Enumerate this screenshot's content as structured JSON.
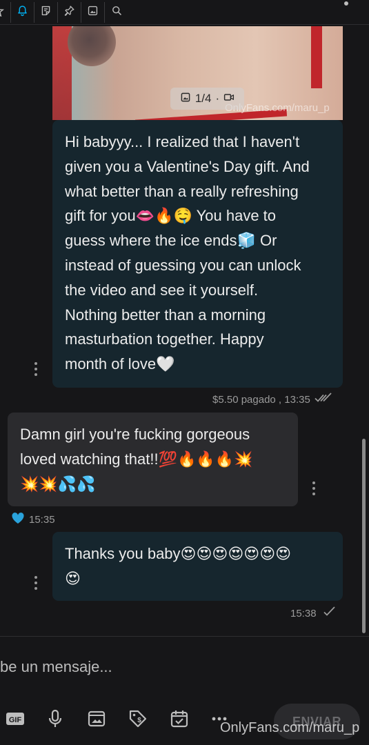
{
  "toolbar": {
    "icons": [
      "star-icon",
      "bell-icon",
      "note-icon",
      "pin-icon",
      "image-icon",
      "search-icon"
    ]
  },
  "messages": [
    {
      "direction": "outgoing",
      "media_counter": "1/4",
      "media_watermark": "OnlyFans.com/maru_p",
      "lines": [
        "Hi babyyy... I realized that I haven't",
        "given you a Valentine's Day gift. And",
        "what better than a really refreshing",
        "gift for you👄🔥🤤 You have to",
        "guess where the ice ends🧊 Or",
        "instead of guessing you can unlock",
        "the video and see it yourself.",
        "Nothing better than a morning",
        "masturbation together. Happy",
        "month of love🤍"
      ],
      "meta": "$5.50 pagado , 13:35"
    },
    {
      "direction": "incoming",
      "lines": [
        "Damn girl you're fucking gorgeous",
        "loved watching that!!💯🔥🔥🔥💥",
        "💥💥💦💦"
      ],
      "meta": "15:35"
    },
    {
      "direction": "outgoing",
      "lines": [
        "Thanks you baby😍😍😍😍😍😍😍",
        "😍"
      ],
      "meta": "15:38"
    }
  ],
  "composer": {
    "placeholder": "be un mensaje...",
    "send_label": "ENVIAR",
    "tools": [
      "gif-icon",
      "microphone-icon",
      "media-vault-icon",
      "price-tag-icon",
      "schedule-icon",
      "more-icon"
    ]
  },
  "watermark": "OnlyFans.com/maru_p",
  "colors": {
    "background": "#161618",
    "outgoing_bubble": "#16262e",
    "incoming_bubble": "#2b2b2e",
    "accent": "#00aff0"
  }
}
